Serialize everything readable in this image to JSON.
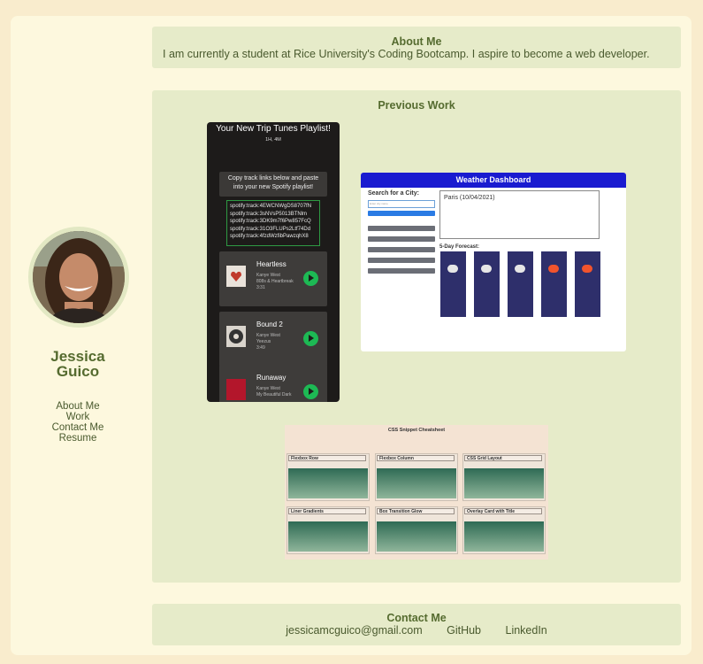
{
  "sidebar": {
    "name_first": "Jessica",
    "name_last": "Guico",
    "nav": [
      "About Me",
      "Work",
      "Contact Me",
      "Resume"
    ]
  },
  "about": {
    "heading": "About Me",
    "text": "I am currently a student at Rice University's Coding Bootcamp. I aspire to become a web developer."
  },
  "work": {
    "heading": "Previous Work",
    "trip_tunes": {
      "title": "Your New Trip Tunes Playlist!",
      "duration": "1H, 4M",
      "instructions_line1": "Copy track links below and paste",
      "instructions_line2": "into your new Spotify playlist!",
      "tracks": [
        "spotify:track:4EWCNWgDS8707fN",
        "spotify:track:3sNVsP5013BTNlm",
        "spotify:track:3DK9m7f6Pw857FcQ",
        "spotify:track:31O3FLUPs2Ltf74Dd",
        "spotify:track:4fzdWzfibPawzqhX8"
      ],
      "songs": [
        {
          "name": "Heartless",
          "artist": "Kanye West",
          "album": "808s & Heartbreak",
          "time": "3:31"
        },
        {
          "name": "Bound 2",
          "artist": "Kanye West",
          "album": "Yeezus",
          "time": "3:49"
        },
        {
          "name": "Runaway",
          "artist": "Kanye West",
          "album": "My Beautiful Dark",
          "time": ""
        }
      ]
    },
    "weather": {
      "title": "Weather Dashboard",
      "search_label": "Search for a City:",
      "search_placeholder": "Enter city name",
      "city_header": "Paris (10/04/2021)",
      "forecast_label": "5-Day Forecast:"
    },
    "cheatsheet": {
      "title": "CSS Snippet Cheatsheet",
      "cards": [
        "Flexbox Row",
        "Flexbox Column",
        "CSS Grid Layout",
        "Liner Gradients",
        "Box Transition Glow",
        "Overlay Card with Title"
      ]
    }
  },
  "contact": {
    "heading": "Contact Me",
    "email": "jessicamcguico@gmail.com",
    "github": "GitHub",
    "linkedin": "LinkedIn"
  }
}
